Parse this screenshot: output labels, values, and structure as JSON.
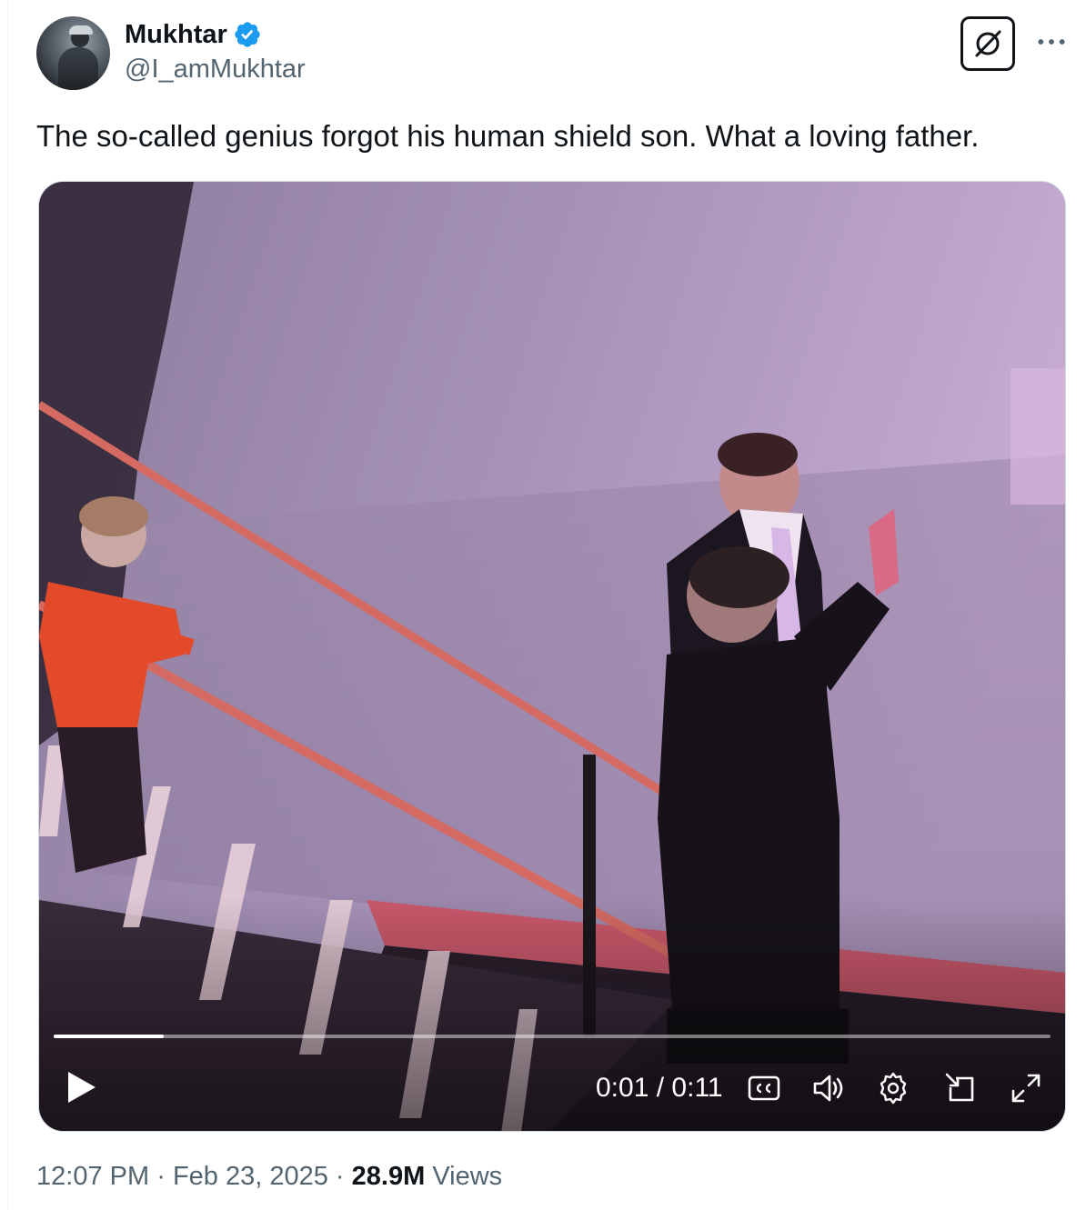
{
  "author": {
    "display_name": "Mukhtar",
    "handle": "@I_amMukhtar",
    "verified": true,
    "verified_color": "#1d9bf0"
  },
  "tweet": {
    "text": "The so-called genius forgot his human shield son. What a loving father."
  },
  "video": {
    "current_time": "0:01",
    "separator": "/",
    "duration": "0:11",
    "progress_fraction": 0.11
  },
  "meta": {
    "time": "12:07 PM",
    "dot1": "·",
    "date": "Feb 23, 2025",
    "dot2": "·",
    "views_count": "28.9M",
    "views_label": "Views"
  },
  "icons": {
    "grok": "grok-icon",
    "more": "more-icon",
    "play": "play-icon",
    "captions": "captions-icon",
    "volume": "volume-icon",
    "settings": "settings-icon",
    "popout": "popout-icon",
    "fullscreen": "fullscreen-icon"
  }
}
